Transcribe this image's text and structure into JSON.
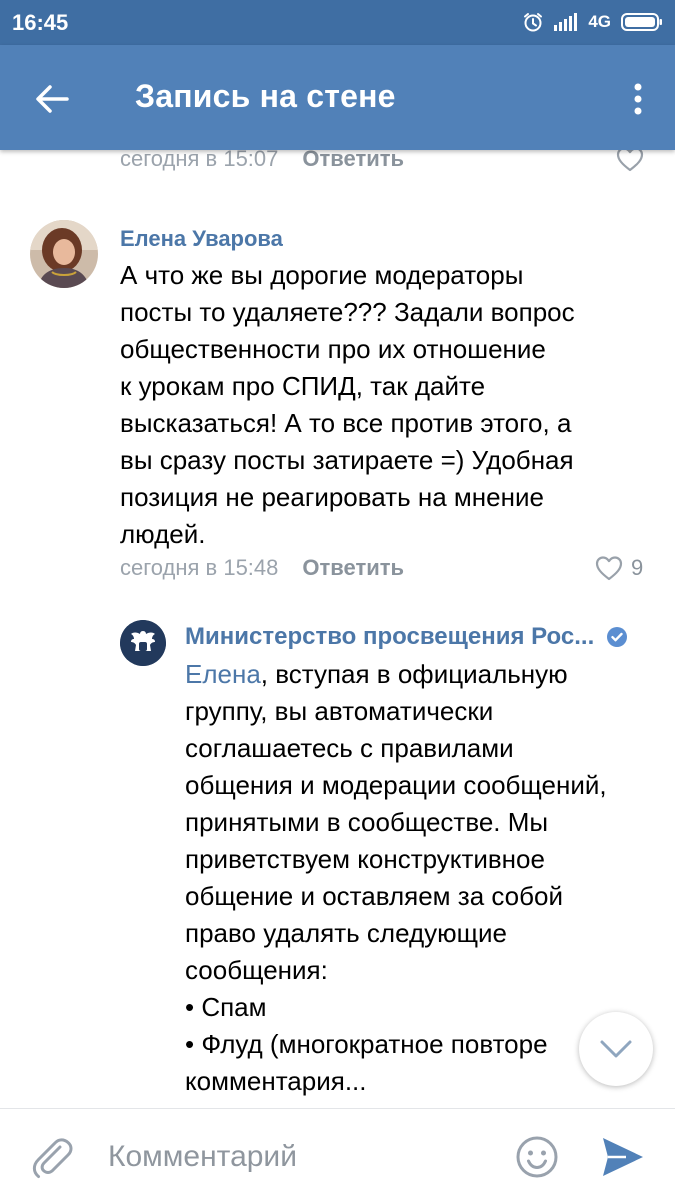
{
  "status_bar": {
    "time": "16:45",
    "network": "4G"
  },
  "app_bar": {
    "title": "Запись на стене"
  },
  "prev_comment": {
    "time": "сегодня в 15:07",
    "reply": "Ответить"
  },
  "comment": {
    "author": "Елена Уварова",
    "text": "А что же вы дорогие модераторы\nпосты то удаляете??? Задали вопрос\nобщественности про их отношение\nк урокам про СПИД, так дайте\nвысказаться! А то все против этого, а\nвы сразу посты затираете =) Удобная\nпозиция не реагировать на мнение\nлюдей.",
    "time": "сегодня в 15:48",
    "reply": "Ответить",
    "likes": "9"
  },
  "reply_comment": {
    "author": "Министерство просвещения Рос...",
    "mention": "Елена",
    "text_after_mention": ", вступая в официальную\nгруппу, вы автоматически\nсоглашаетесь с правилами\nобщения и модерации сообщений,\nпринятыми в сообществе. Мы\nприветствуем конструктивное\nобщение и оставляем за собой\nправо удалять следующие\nсообщения:\n• Спам\n• Флуд (многократное повторе\nкомментария..."
  },
  "input_bar": {
    "placeholder": "Комментарий"
  },
  "colors": {
    "status_bar": "#3f6ea3",
    "app_bar": "#5181b8",
    "link": "#4c77a8",
    "send": "#5181b8"
  }
}
